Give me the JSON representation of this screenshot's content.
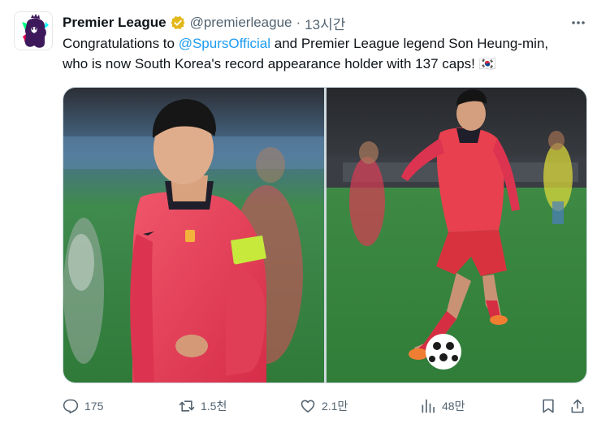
{
  "author": {
    "display_name": "Premier League",
    "handle": "@premierleague",
    "separator": "·",
    "time": "13시간"
  },
  "tweet": {
    "text_before": "Congratulations to ",
    "mention": "@SpursOfficial",
    "text_after": " and Premier League legend Son Heung-min, who is now South Korea's record appearance holder with 137 caps! ",
    "flag": "🇰🇷"
  },
  "media": {
    "photos": [
      {
        "icon": "player-portrait-photo"
      },
      {
        "icon": "player-dribbling-photo"
      }
    ]
  },
  "actions": {
    "reply_count": "175",
    "retweet_count": "1.5천",
    "like_count": "2.1만",
    "views_count": "48만"
  },
  "colors": {
    "accent": "#1d9bf0",
    "secondary_text": "#536471",
    "verified_badge": "#e2b719"
  }
}
